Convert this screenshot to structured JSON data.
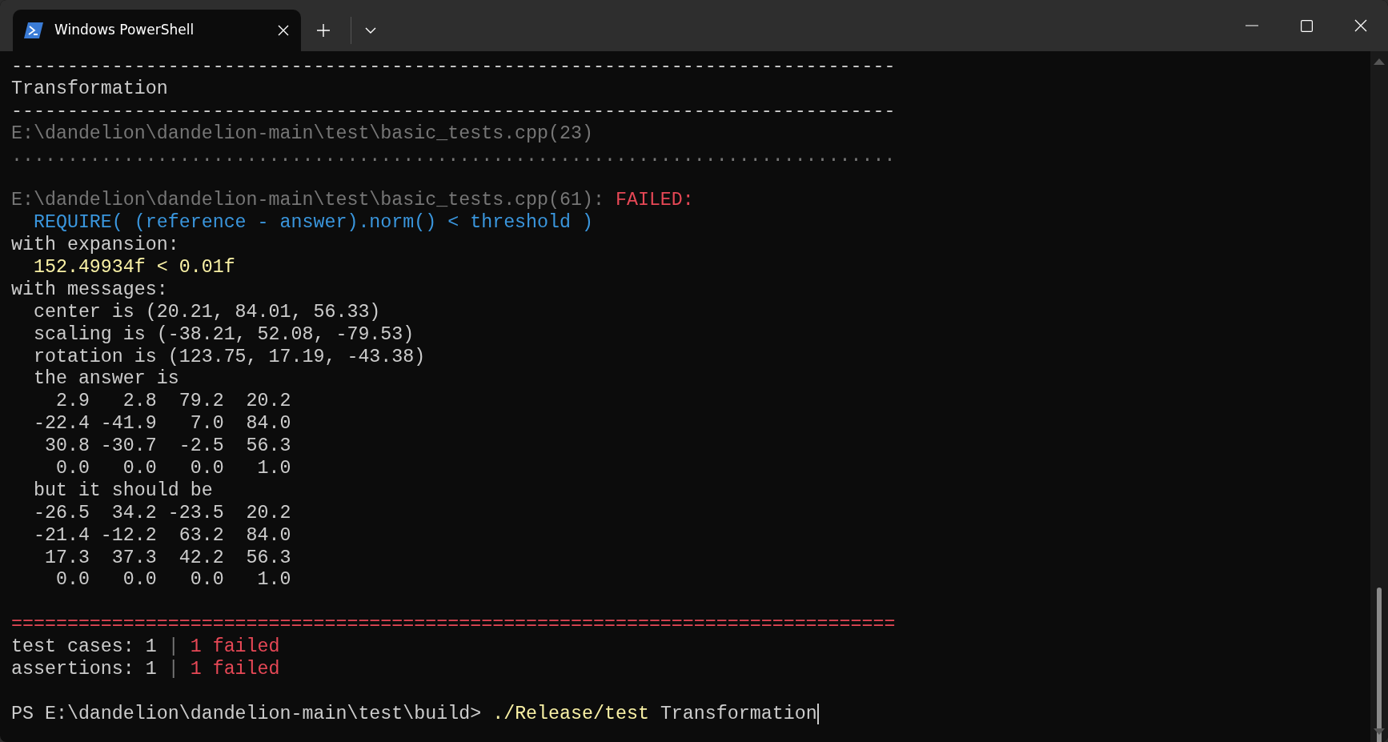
{
  "window": {
    "tab": {
      "title": "Windows PowerShell",
      "selected": true
    }
  },
  "terminal": {
    "lines": [
      {
        "kind": "output",
        "segments": [
          {
            "kind": "plain",
            "text": "-------------------------------------------------------------------------------"
          }
        ]
      },
      {
        "kind": "output",
        "segments": [
          {
            "kind": "plain",
            "text": "Transformation"
          }
        ]
      },
      {
        "kind": "output",
        "segments": [
          {
            "kind": "plain",
            "text": "-------------------------------------------------------------------------------"
          }
        ]
      },
      {
        "kind": "output",
        "segments": [
          {
            "kind": "dim",
            "text": "E:\\dandelion\\dandelion-main\\test\\basic_tests.cpp(23)"
          }
        ]
      },
      {
        "kind": "output",
        "segments": [
          {
            "kind": "dim",
            "text": "..............................................................................."
          }
        ]
      },
      {
        "kind": "blank"
      },
      {
        "kind": "output",
        "segments": [
          {
            "kind": "dim",
            "text": "E:\\dandelion\\dandelion-main\\test\\basic_tests.cpp(61):"
          },
          {
            "kind": "error",
            "text": "FAILED:"
          }
        ]
      },
      {
        "kind": "output",
        "segments": [
          {
            "kind": "code",
            "text": "  REQUIRE( (reference - answer).norm() < threshold )"
          }
        ]
      },
      {
        "kind": "output",
        "segments": [
          {
            "kind": "plain",
            "text": "with expansion:"
          }
        ]
      },
      {
        "kind": "output",
        "segments": [
          {
            "kind": "value",
            "text": "  152.49934f < 0.01f"
          }
        ]
      },
      {
        "kind": "output",
        "segments": [
          {
            "kind": "plain",
            "text": "with messages:"
          }
        ]
      },
      {
        "kind": "output",
        "segments": [
          {
            "kind": "plain",
            "text": "  center is (20.21, 84.01, 56.33)"
          }
        ]
      },
      {
        "kind": "output",
        "segments": [
          {
            "kind": "plain",
            "text": "  scaling is (-38.21, 52.08, -79.53)"
          }
        ]
      },
      {
        "kind": "output",
        "segments": [
          {
            "kind": "plain",
            "text": "  rotation is (123.75, 17.19, -43.38)"
          }
        ]
      },
      {
        "kind": "output",
        "segments": [
          {
            "kind": "plain",
            "text": "  the answer is"
          }
        ]
      },
      {
        "kind": "output",
        "segments": [
          {
            "kind": "plain",
            "text": "    2.9   2.8  79.2  20.2"
          }
        ]
      },
      {
        "kind": "output",
        "segments": [
          {
            "kind": "plain",
            "text": "  -22.4 -41.9   7.0  84.0"
          }
        ]
      },
      {
        "kind": "output",
        "segments": [
          {
            "kind": "plain",
            "text": "   30.8 -30.7  -2.5  56.3"
          }
        ]
      },
      {
        "kind": "output",
        "segments": [
          {
            "kind": "plain",
            "text": "    0.0   0.0   0.0   1.0"
          }
        ]
      },
      {
        "kind": "output",
        "segments": [
          {
            "kind": "plain",
            "text": "  but it should be"
          }
        ]
      },
      {
        "kind": "output",
        "segments": [
          {
            "kind": "plain",
            "text": "  -26.5  34.2 -23.5  20.2"
          }
        ]
      },
      {
        "kind": "output",
        "segments": [
          {
            "kind": "plain",
            "text": "  -21.4 -12.2  63.2  84.0"
          }
        ]
      },
      {
        "kind": "output",
        "segments": [
          {
            "kind": "plain",
            "text": "   17.3  37.3  42.2  56.3"
          }
        ]
      },
      {
        "kind": "output",
        "segments": [
          {
            "kind": "plain",
            "text": "    0.0   0.0   0.0   1.0"
          }
        ]
      },
      {
        "kind": "blank"
      },
      {
        "kind": "output",
        "segments": [
          {
            "kind": "error",
            "text": "==============================================================================="
          }
        ]
      },
      {
        "kind": "output",
        "segments": [
          {
            "kind": "plain",
            "text": "test cases: 1"
          },
          {
            "kind": "dim",
            "text": "|"
          },
          {
            "kind": "error",
            "text": "1 failed"
          }
        ]
      },
      {
        "kind": "output",
        "segments": [
          {
            "kind": "plain",
            "text": "assertions: 1"
          },
          {
            "kind": "dim",
            "text": "|"
          },
          {
            "kind": "error",
            "text": "1 failed"
          }
        ]
      },
      {
        "kind": "blank"
      },
      {
        "kind": "output",
        "segments": [
          {
            "kind": "plain",
            "text": "PS E:\\dandelion\\dandelion-main\\test\\build>"
          },
          {
            "kind": "command",
            "text": "./Release/test"
          },
          {
            "kind": "plain",
            "text": "Transformation"
          },
          {
            "kind": "cursor"
          }
        ]
      }
    ]
  }
}
